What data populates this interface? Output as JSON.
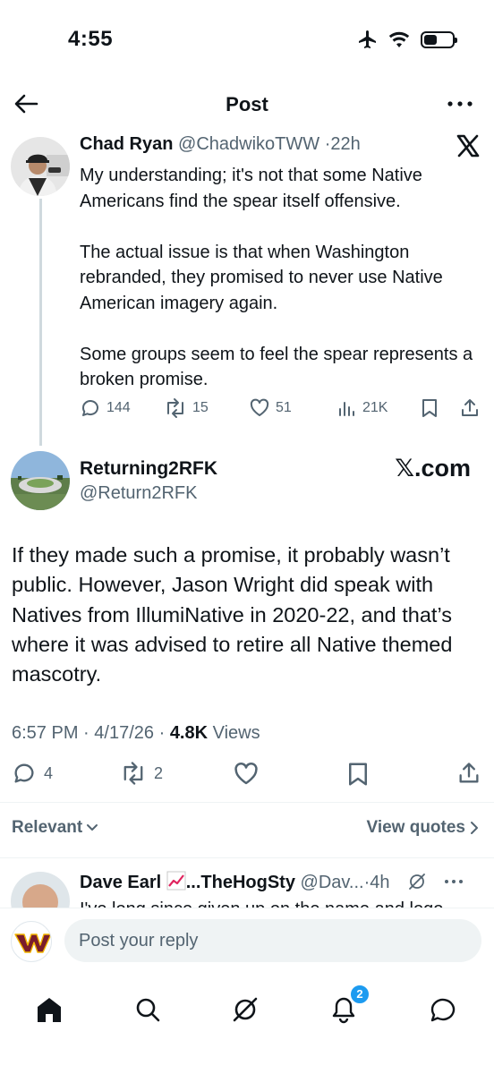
{
  "status_bar": {
    "time": "4:55",
    "battery_level_pct": 45
  },
  "nav": {
    "title": "Post"
  },
  "parent_tweet": {
    "name": "Chad Ryan",
    "handle": "@ChadwikoTWW",
    "separator": "·",
    "age": "22h",
    "paragraphs": [
      "My understanding; it's not that some Native Americans find the spear itself offensive.",
      "The actual issue is that when Washington rebranded, they promised to never use Native American imagery again.",
      "Some groups seem to feel the spear represents a broken promise."
    ],
    "replies": "144",
    "reposts": "15",
    "likes": "51",
    "views": "21K"
  },
  "main_tweet": {
    "name": "Returning2RFK",
    "handle": "@Return2RFK",
    "source_label": "𝕏.com",
    "text": "If they made such a promise, it probably wasn’t public. However, Jason Wright did speak with Natives from IllumiNative in 2020-22, and that’s where it was advised to retire all Native themed mascotry.",
    "time": "6:57 PM",
    "date": "4/17/26",
    "meta_sep": "·",
    "views_count": "4.8K",
    "views_label": "Views",
    "replies": "4",
    "reposts": "2"
  },
  "sort": {
    "relevant_label": "Relevant",
    "view_quotes_label": "View quotes"
  },
  "reply_tweet": {
    "name": "Dave Earl",
    "name_suffix": "...TheHogSty",
    "handle": "@Dav...",
    "separator": "·",
    "age": "4h",
    "preview": "I've long since given up on the name and logo"
  },
  "compose": {
    "placeholder": "Post your reply"
  },
  "tabbar": {
    "notifications_count": "2"
  },
  "colors": {
    "accent": "#1d9bf0",
    "text": "#0f1419",
    "muted": "#536471",
    "divider": "#eff3f4",
    "commanders_burgundy": "#7a1d2c",
    "commanders_gold": "#f2b600"
  }
}
